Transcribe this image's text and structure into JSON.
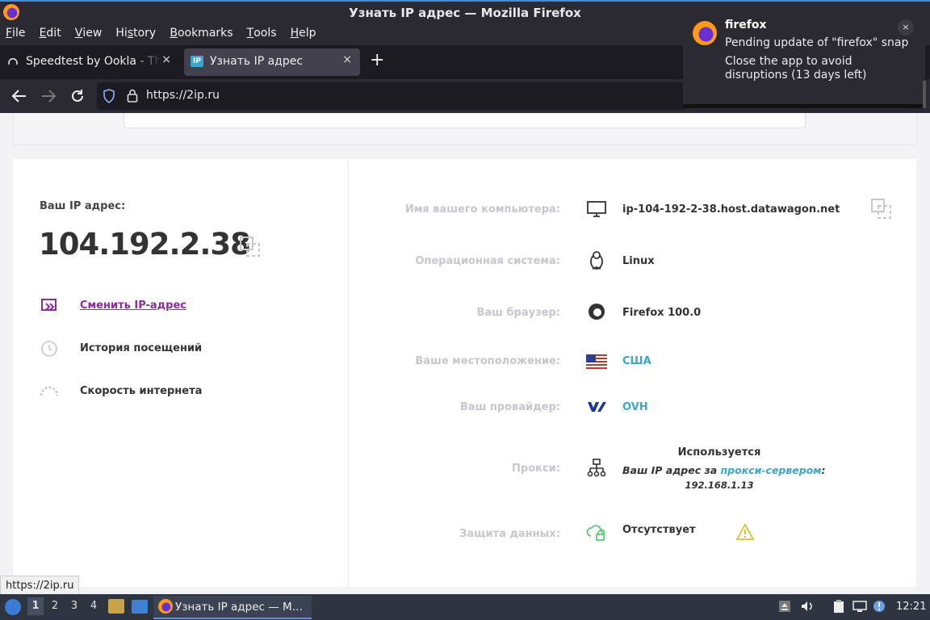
{
  "window": {
    "title": "Узнать IP адрес — Mozilla Firefox"
  },
  "menu": {
    "items": [
      {
        "label": "File",
        "ul": "F",
        "rest": "ile"
      },
      {
        "label": "Edit",
        "ul": "E",
        "rest": "dit"
      },
      {
        "label": "View",
        "ul": "V",
        "rest": "iew"
      },
      {
        "label": "History",
        "pre": "Hi",
        "ul": "s",
        "rest": "tory"
      },
      {
        "label": "Bookmarks",
        "ul": "B",
        "rest": "ookmarks"
      },
      {
        "label": "Tools",
        "ul": "T",
        "rest": "ools"
      },
      {
        "label": "Help",
        "ul": "H",
        "rest": "elp"
      }
    ]
  },
  "tabs": [
    {
      "label": "Speedtest by Ookla - The Global Broadband Speed Test",
      "close": "×"
    },
    {
      "label": "Узнать IP адрес",
      "close": "×",
      "favicon_text": "IP"
    }
  ],
  "toolbar": {
    "new_tab": "+",
    "url": "https://2ip.ru"
  },
  "notification": {
    "app": "firefox",
    "line1": "Pending update of \"firefox\" snap",
    "line2": "Close the app to avoid disruptions (13 days left)",
    "close": "×"
  },
  "page": {
    "ip_label": "Ваш IP адрес:",
    "ip_value": "104.192.2.38",
    "actions": [
      {
        "label": "Сменить IP-адрес",
        "icon": "change-ip-icon"
      },
      {
        "label": "История посещений",
        "icon": "history-icon"
      },
      {
        "label": "Скорость интернета",
        "icon": "speed-icon"
      }
    ],
    "details": {
      "computer_label": "Имя вашего компьютера:",
      "computer_value": "ip-104-192-2-38.host.datawagon.net",
      "os_label": "Операционная система:",
      "os_value": "Linux",
      "browser_label": "Ваш браузер:",
      "browser_value": "Firefox 100.0",
      "location_label": "Ваше местоположение:",
      "location_value": "США",
      "provider_label": "Ваш провайдер:",
      "provider_value": "OVH",
      "proxy_label": "Прокси:",
      "proxy_status": "Используется",
      "proxy_prefix": "Ваш IP адрес за ",
      "proxy_link": "прокси-сервером",
      "proxy_suffix": ":",
      "proxy_ip": "192.168.1.13",
      "protection_label": "Защита данных:",
      "protection_value": "Отсутствует"
    }
  },
  "status_bar": {
    "url": "https://2ip.ru"
  },
  "taskbar": {
    "workspaces": [
      "1",
      "2",
      "3",
      "4"
    ],
    "active_window": "Узнать IP адрес — M…",
    "clock": "12:21"
  }
}
